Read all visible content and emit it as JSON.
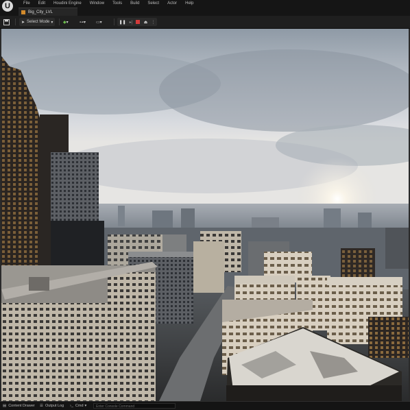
{
  "menu": [
    "File",
    "Edit",
    "Houdini Engine",
    "Window",
    "Tools",
    "Build",
    "Select",
    "Actor",
    "Help"
  ],
  "tab": {
    "label": "Big_City_LVL"
  },
  "toolbar": {
    "mode_label": "Select Mode"
  },
  "statusbar": {
    "content_drawer": "Content Drawer",
    "output_log": "Output Log",
    "cmd": "Cmd",
    "console_placeholder": "Enter Console Command"
  },
  "colors": {
    "accent": "#d28a2c",
    "stop": "#d23a3a",
    "bg": "#151515"
  }
}
